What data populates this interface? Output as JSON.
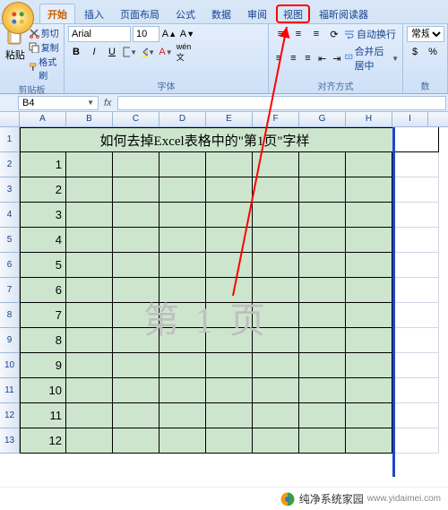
{
  "tabs": {
    "home": "开始",
    "insert": "插入",
    "layout": "页面布局",
    "formula": "公式",
    "data": "数据",
    "review": "审阅",
    "view": "视图",
    "foxitreader": "福昕阅读器"
  },
  "ribbon": {
    "clipboard": {
      "paste": "粘贴",
      "cut": "剪切",
      "copy": "复制",
      "formatpainter": "格式刷",
      "title": "剪贴板"
    },
    "font": {
      "name": "Arial",
      "size": "10",
      "title": "字体"
    },
    "align": {
      "wrap": "自动换行",
      "merge": "合并后居中",
      "title": "对齐方式"
    },
    "number": {
      "format": "常规",
      "title": "数"
    }
  },
  "namebox": "B4",
  "columns": [
    "A",
    "B",
    "C",
    "D",
    "E",
    "F",
    "G",
    "H",
    "I"
  ],
  "rows": [
    "1",
    "2",
    "3",
    "4",
    "5",
    "6",
    "7",
    "8",
    "9",
    "10",
    "11",
    "12",
    "13"
  ],
  "sheet": {
    "title": "如何去掉Excel表格中的\"第1页\"字样",
    "col_a": [
      "1",
      "2",
      "3",
      "4",
      "5",
      "6",
      "7",
      "8",
      "9",
      "10",
      "11",
      "12"
    ]
  },
  "watermark": "第 1 页",
  "footer": {
    "brand": "纯净系统家园",
    "url": "www.yidaimei.com"
  }
}
